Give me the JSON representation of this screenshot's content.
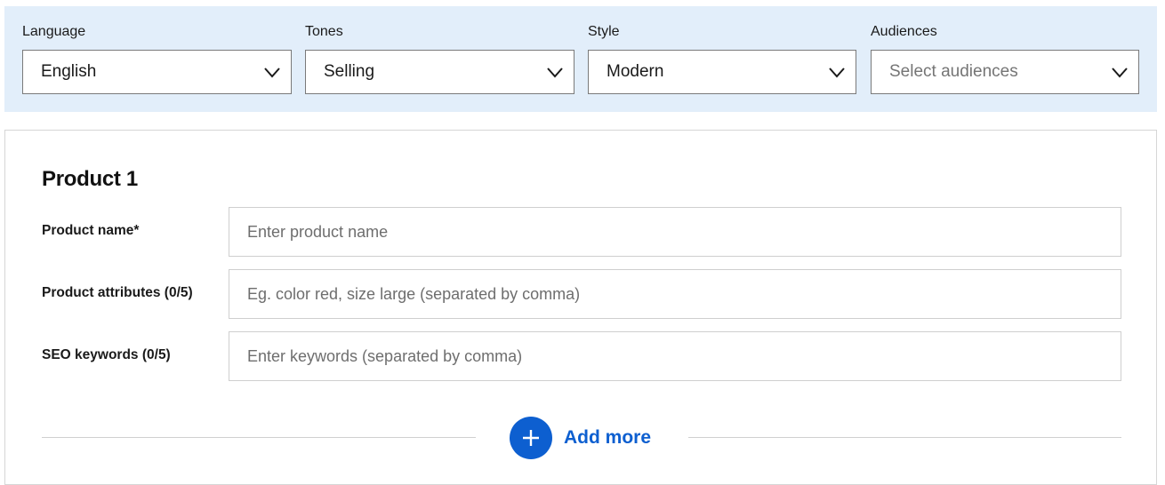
{
  "filters": [
    {
      "label": "Language",
      "value": "English",
      "placeholder": false
    },
    {
      "label": "Tones",
      "value": "Selling",
      "placeholder": false
    },
    {
      "label": "Style",
      "value": "Modern",
      "placeholder": false
    },
    {
      "label": "Audiences",
      "value": "Select audiences",
      "placeholder": true
    }
  ],
  "product": {
    "title": "Product 1",
    "fields": [
      {
        "label": "Product name*",
        "placeholder": "Enter product name"
      },
      {
        "label": "Product attributes (0/5)",
        "placeholder": "Eg. color red, size large (separated by comma)"
      },
      {
        "label": "SEO keywords (0/5)",
        "placeholder": "Enter keywords (separated by comma)"
      }
    ]
  },
  "add_more": {
    "label": "Add more",
    "icon": "plus-icon"
  },
  "colors": {
    "accent": "#0d5fd0",
    "filter_bar_bg": "#e2eefa"
  }
}
